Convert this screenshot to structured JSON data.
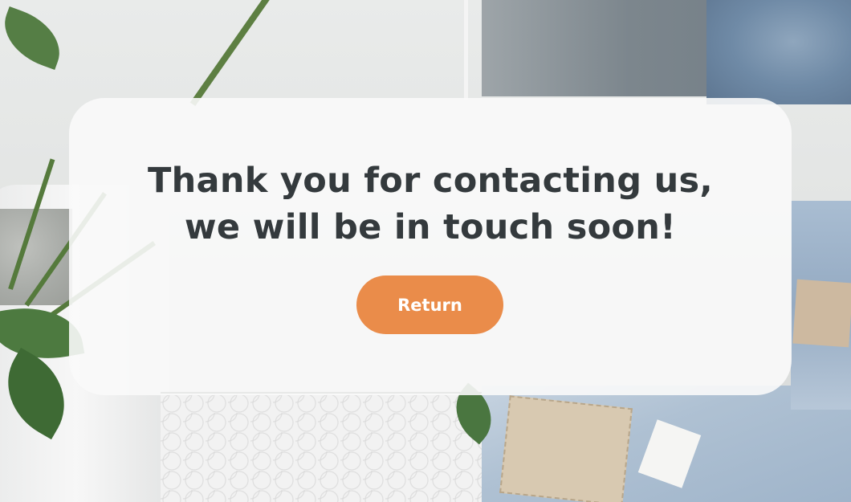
{
  "message": {
    "line1": "Thank you for contacting us,",
    "line2": "we will be in touch soon!"
  },
  "actions": {
    "return_label": "Return"
  },
  "colors": {
    "button_bg": "#ea8c4a",
    "button_text": "#ffffff",
    "heading_text": "#343a3d",
    "card_bg": "rgba(250,250,250,0.9)"
  }
}
